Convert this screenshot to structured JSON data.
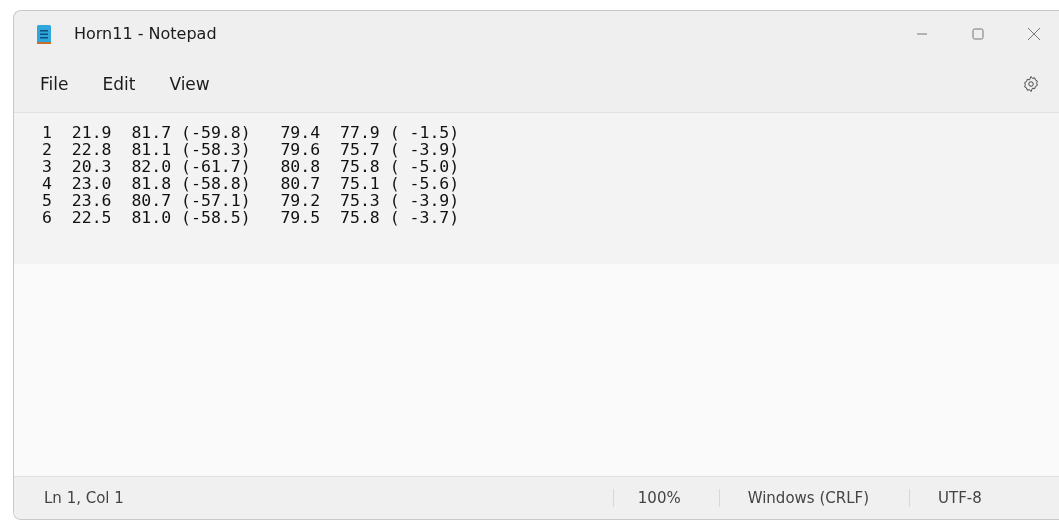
{
  "window": {
    "title": "Horn11 - Notepad"
  },
  "menu": [
    "File",
    "Edit",
    "View"
  ],
  "editor": {
    "lines": [
      "1  21.9  81.7 (-59.8)   79.4  77.9 ( -1.5)",
      "2  22.8  81.1 (-58.3)   79.6  75.7 ( -3.9)",
      "3  20.3  82.0 (-61.7)   80.8  75.8 ( -5.0)",
      "4  23.0  81.8 (-58.8)   80.7  75.1 ( -5.6)",
      "5  23.6  80.7 (-57.1)   79.2  75.3 ( -3.9)",
      "6  22.5  81.0 (-58.5)   79.5  75.8 ( -3.7)"
    ]
  },
  "status_bar": {
    "position": "Ln 1, Col 1",
    "zoom": "100%",
    "line_ending": "Windows (CRLF)",
    "encoding": "UTF-8"
  }
}
